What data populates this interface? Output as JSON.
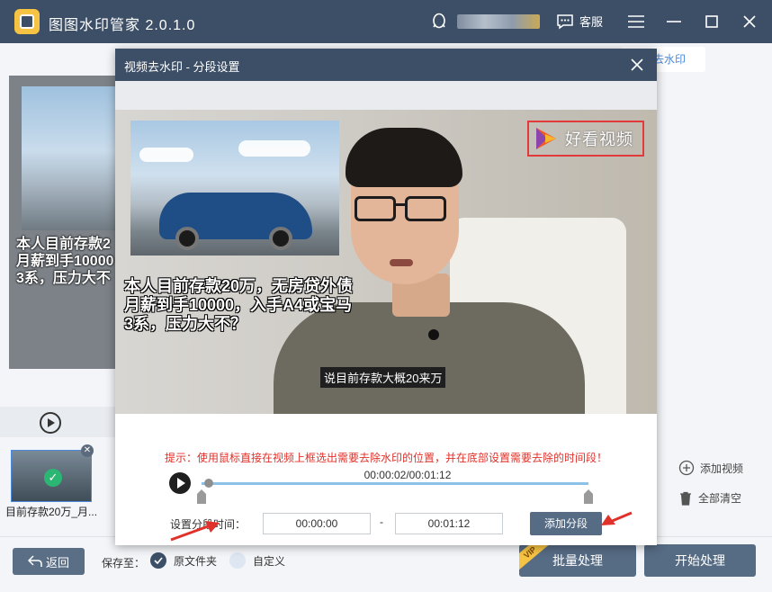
{
  "app": {
    "title": "图图水印管家  2.0.1.0",
    "service_label": "客服"
  },
  "background": {
    "top_button": "去水印",
    "caption": "本人目前存款2\n月薪到手10000\n3系，压力大不",
    "thumb_label": "目前存款20万_月...",
    "add_video": "添加视频",
    "clear_all": "全部清空"
  },
  "bottom": {
    "back": "返回",
    "save_to": "保存至：",
    "option_original": "原文件夹",
    "option_custom": "自定义",
    "batch": "批量处理",
    "vip": "VIP",
    "start": "开始处理"
  },
  "dialog": {
    "title": "视频去水印 - 分段设置",
    "video": {
      "caption": "本人目前存款20万，无房贷外债\n月薪到手10000，入手A4或宝马\n3系，压力大不？",
      "subtitle": "说目前存款大概20来万",
      "logo": "好看视频"
    },
    "hint": "提示：使用鼠标直接在视频上框选出需要去除水印的位置，并在底部设置需要去除的时间段！",
    "time_display": "00:00:02/00:01:12",
    "range_label": "设置分段时间：",
    "start_time": "00:00:00",
    "end_time": "00:01:12",
    "separator": "-",
    "add_segment": "添加分段"
  },
  "colors": {
    "titlebar": "#3d4f66",
    "accent_blue": "#4a89dc",
    "hint_red": "#e0312a",
    "button": "#566b84"
  },
  "icons": [
    "app-logo-icon",
    "qq-icon",
    "service-icon",
    "menu-icon",
    "minimize-icon",
    "maximize-icon",
    "close-icon",
    "play-icon",
    "check-icon",
    "add-circle-icon",
    "trash-icon",
    "back-arrow-icon"
  ]
}
